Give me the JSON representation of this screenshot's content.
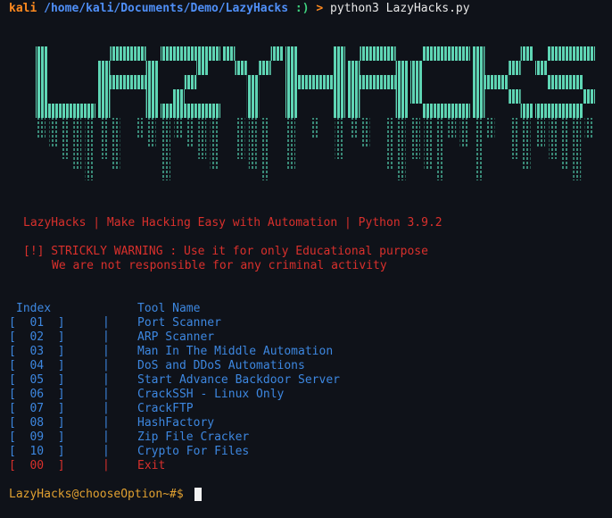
{
  "prompt": {
    "user": "kali",
    "path": "/home/kali/Documents/Demo/LazyHacks",
    "face": ":)",
    "arrow": ">",
    "command": "python3 LazyHacks.py"
  },
  "banner": {
    "text": "LAZYHACKS",
    "letters": [
      "L",
      "A",
      "Z",
      "Y",
      "H",
      "A",
      "C",
      "K",
      "S"
    ],
    "color": "#5fd5b4"
  },
  "tagline": "LazyHacks | Make Hacking Easy with Automation | Python 3.9.2",
  "warning": {
    "line1": "[!] STRICKLY WARNING : Use it for only Educational purpose",
    "line2": "We are not responsible for any criminal activity"
  },
  "menu": {
    "header_index": "Index",
    "header_tool": "Tool Name",
    "items": [
      {
        "index": "[  01  ]",
        "name": "Port Scanner",
        "color": "blue"
      },
      {
        "index": "[  02  ]",
        "name": "ARP Scanner",
        "color": "blue"
      },
      {
        "index": "[  03  ]",
        "name": "Man In The Middle Automation",
        "color": "blue"
      },
      {
        "index": "[  04  ]",
        "name": "DoS and DDoS Automations",
        "color": "blue"
      },
      {
        "index": "[  05  ]",
        "name": "Start Advance Backdoor Server",
        "color": "blue"
      },
      {
        "index": "[  06  ]",
        "name": "CrackSSH - Linux Only",
        "color": "blue"
      },
      {
        "index": "[  07  ]",
        "name": "CrackFTP",
        "color": "blue"
      },
      {
        "index": "[  08  ]",
        "name": "HashFactory",
        "color": "blue"
      },
      {
        "index": "[  09  ]",
        "name": "Zip File Cracker",
        "color": "blue"
      },
      {
        "index": "[  10  ]",
        "name": "Crypto For Files",
        "color": "blue"
      },
      {
        "index": "[  00  ]",
        "name": "Exit",
        "color": "red"
      }
    ],
    "separator": "|"
  },
  "input_prompt": "LazyHacks@chooseOption~#$"
}
